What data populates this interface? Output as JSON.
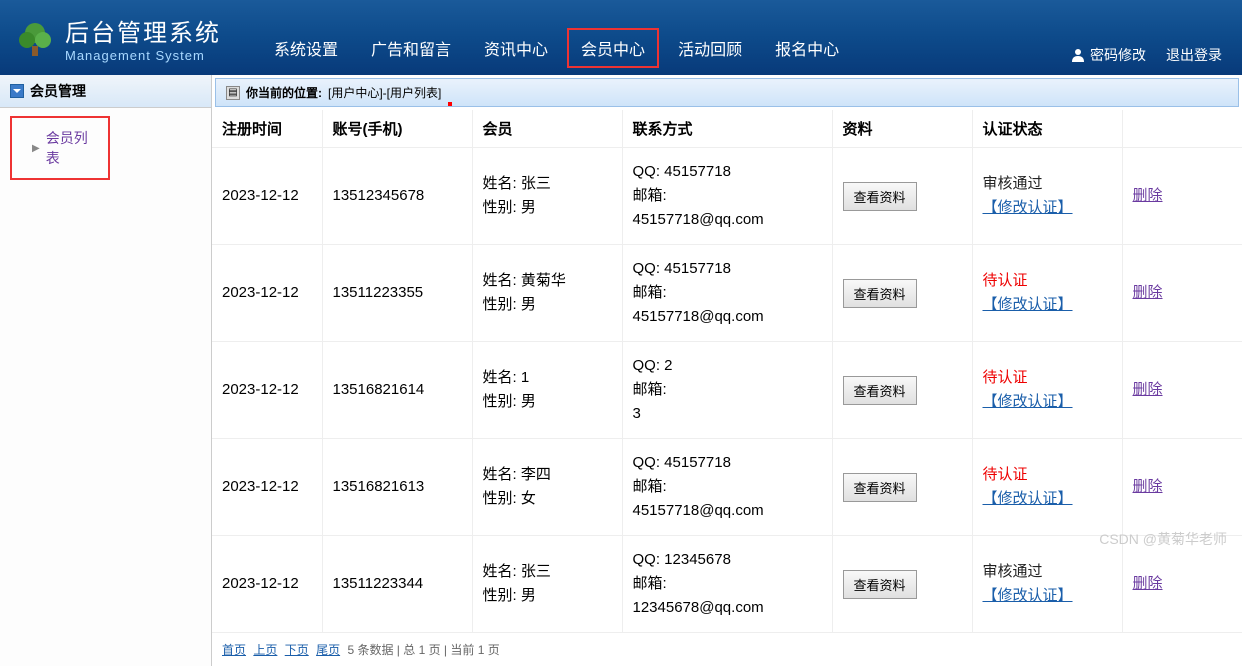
{
  "header": {
    "title": "后台管理系统",
    "subtitle": "Management System",
    "nav": [
      {
        "label": "系统设置",
        "highlighted": false
      },
      {
        "label": "广告和留言",
        "highlighted": false
      },
      {
        "label": "资讯中心",
        "highlighted": false
      },
      {
        "label": "会员中心",
        "highlighted": true
      },
      {
        "label": "活动回顾",
        "highlighted": false
      },
      {
        "label": "报名中心",
        "highlighted": false
      }
    ],
    "right": {
      "change_pwd": "密码修改",
      "logout": "退出登录"
    }
  },
  "sidebar": {
    "group_title": "会员管理",
    "items": [
      {
        "label": "会员列表"
      }
    ]
  },
  "breadcrumb": {
    "prefix": "你当前的位置:",
    "path": "[用户中心]-[用户列表]"
  },
  "table": {
    "columns": {
      "reg_time": "注册时间",
      "account": "账号(手机)",
      "member": "会员",
      "contact": "联系方式",
      "profile": "资料",
      "auth": "认证状态",
      "op": ""
    },
    "labels": {
      "name": "姓名:",
      "gender": "性别:",
      "qq": "QQ:",
      "email": "邮箱:",
      "view_btn": "查看资料",
      "modify_auth": "【修改认证】",
      "delete": "删除"
    },
    "rows": [
      {
        "reg_time": "2023-12-12",
        "account": "13512345678",
        "name": "张三",
        "gender": "男",
        "qq": "45157718",
        "email": "45157718@qq.com",
        "status": "审核通过",
        "status_class": "status-pass"
      },
      {
        "reg_time": "2023-12-12",
        "account": "13511223355",
        "name": "黄菊华",
        "gender": "男",
        "qq": "45157718",
        "email": "45157718@qq.com",
        "status": "待认证",
        "status_class": "status-wait"
      },
      {
        "reg_time": "2023-12-12",
        "account": "13516821614",
        "name": "1",
        "gender": "男",
        "qq": "2",
        "email": "3",
        "status": "待认证",
        "status_class": "status-wait"
      },
      {
        "reg_time": "2023-12-12",
        "account": "13516821613",
        "name": "李四",
        "gender": "女",
        "qq": "45157718",
        "email": "45157718@qq.com",
        "status": "待认证",
        "status_class": "status-wait"
      },
      {
        "reg_time": "2023-12-12",
        "account": "13511223344",
        "name": "张三",
        "gender": "男",
        "qq": "12345678",
        "email": "12345678@qq.com",
        "status": "审核通过",
        "status_class": "status-pass"
      }
    ]
  },
  "pager": {
    "first": "首页",
    "prev": "上页",
    "next": "下页",
    "last": "尾页",
    "info": "5 条数据 | 总 1 页 | 当前 1 页"
  },
  "watermark": "CSDN @黄菊华老师"
}
